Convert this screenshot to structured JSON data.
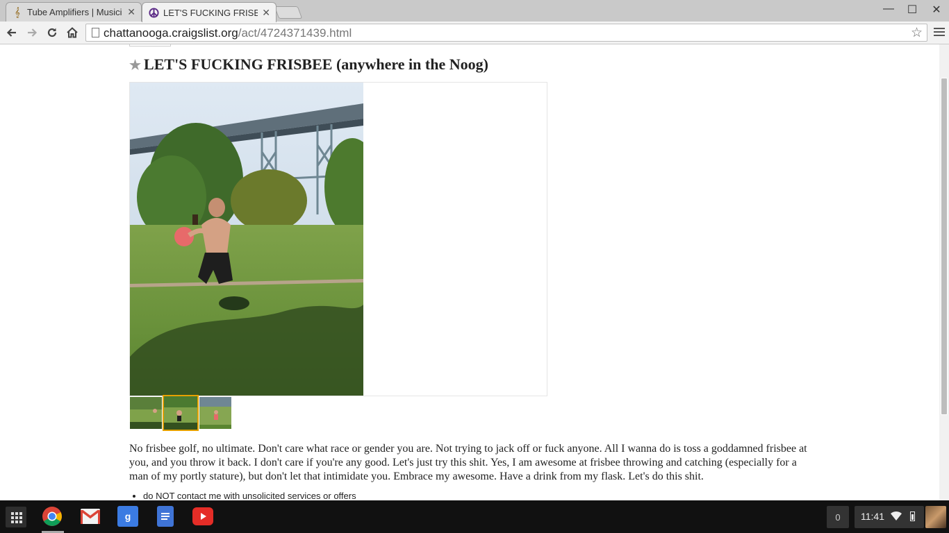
{
  "browser": {
    "tabs": [
      {
        "title": "Tube Amplifiers | Musici",
        "icon": "guitar-favicon"
      },
      {
        "title": "LET'S FUCKING FRISBEE",
        "icon": "peace-sign-favicon"
      }
    ],
    "url_host": "chattanooga.craigslist.org",
    "url_path": "/act/4724371439.html"
  },
  "post": {
    "title": "LET'S FUCKING FRISBEE (anywhere in the Noog)",
    "body": "No frisbee golf, no ultimate. Don't care what race or gender you are. Not trying to jack off or fuck anyone. All I wanna do is toss a goddamned frisbee at you, and you throw it back. I don't care if you're any good. Let's just try this shit. Yes, I am awesome at frisbee throwing and catching (especially for a man of my portly stature), but don't let that intimidate you. Embrace my awesome. Have a drink from my flask. Let's do this shit.",
    "notices": [
      "do NOT contact me with unsolicited services or offers"
    ],
    "thumbnail_count": 3,
    "selected_thumbnail": 2
  },
  "taskbar": {
    "apps": [
      "chrome-icon",
      "gmail-icon",
      "google-search-icon",
      "docs-icon",
      "youtube-icon"
    ],
    "notification_count": "0",
    "clock": "11:41"
  },
  "colors": {
    "thumb_selected": "#e6a100",
    "youtube_red": "#e52d27",
    "google_blue": "#3b7be2"
  }
}
